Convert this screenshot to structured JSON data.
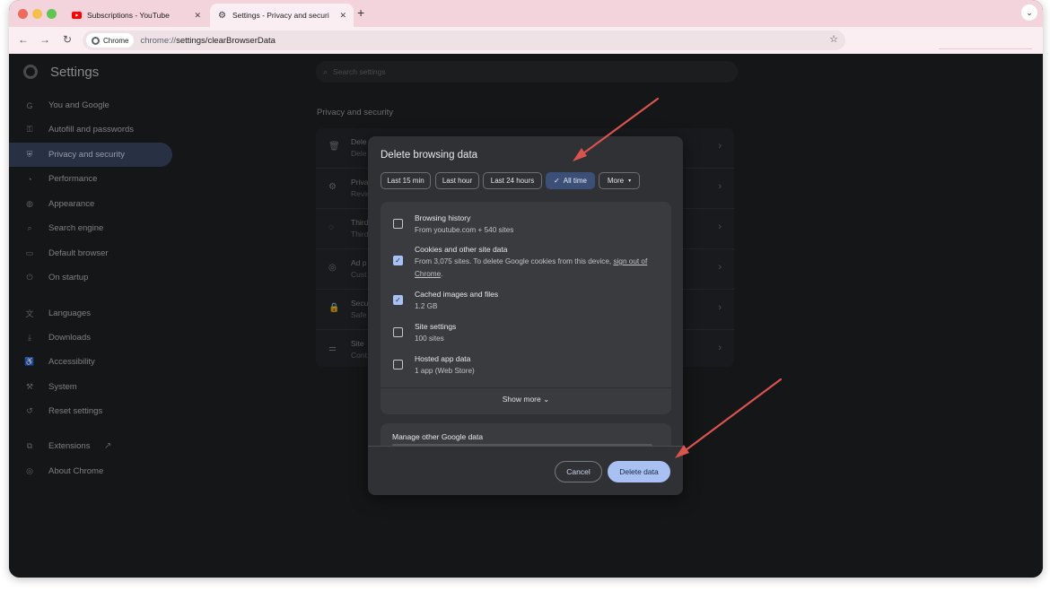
{
  "tabs": [
    {
      "title": "Subscriptions - YouTube",
      "icon": "youtube-icon",
      "close": "✕"
    },
    {
      "title": "Settings - Privacy and securi",
      "icon": "gear-icon",
      "close": "✕"
    }
  ],
  "new_tab": "+",
  "tab_menu": "⌄",
  "toolbar": {
    "back": "←",
    "forward": "→",
    "reload": "↻",
    "chip_label": "Chrome",
    "url_scheme": "chrome://",
    "url_rest": "settings/clearBrowserData",
    "star": "☆"
  },
  "settings": {
    "title": "Settings",
    "search_placeholder": "Search settings",
    "nav": [
      {
        "label": "You and Google",
        "icon": "google-icon",
        "glyph": "G"
      },
      {
        "label": "Autofill and passwords",
        "icon": "key-icon",
        "glyph": "⚿"
      },
      {
        "label": "Privacy and security",
        "icon": "shield-icon",
        "glyph": "⛨"
      },
      {
        "label": "Performance",
        "icon": "speedometer-icon",
        "glyph": "◔"
      },
      {
        "label": "Appearance",
        "icon": "palette-icon",
        "glyph": "◍"
      },
      {
        "label": "Search engine",
        "icon": "search-icon",
        "glyph": "⌕"
      },
      {
        "label": "Default browser",
        "icon": "browser-icon",
        "glyph": "▭"
      },
      {
        "label": "On startup",
        "icon": "power-icon",
        "glyph": "⏻"
      },
      {
        "label": "Languages",
        "icon": "translate-icon",
        "glyph": "文"
      },
      {
        "label": "Downloads",
        "icon": "download-icon",
        "glyph": "⤓"
      },
      {
        "label": "Accessibility",
        "icon": "accessibility-icon",
        "glyph": "♿"
      },
      {
        "label": "System",
        "icon": "wrench-icon",
        "glyph": "⚒"
      },
      {
        "label": "Reset settings",
        "icon": "reset-icon",
        "glyph": "↺"
      },
      {
        "label": "Extensions",
        "icon": "puzzle-icon",
        "glyph": "⧉"
      },
      {
        "label": "About Chrome",
        "icon": "chrome-icon",
        "glyph": "◎"
      }
    ],
    "extensions_external": "↗",
    "section_title": "Privacy and security",
    "rows": [
      {
        "title": "Dele",
        "sub": "Dele",
        "icon": "trash-icon",
        "glyph": "🗑"
      },
      {
        "title": "Priva",
        "sub": "Revie",
        "icon": "privacy-guide-icon",
        "glyph": "⚙"
      },
      {
        "title": "Third",
        "sub": "Third",
        "icon": "cookie-icon",
        "glyph": "◌"
      },
      {
        "title": "Ad p",
        "sub": "Cust",
        "icon": "ad-privacy-icon",
        "glyph": "◎"
      },
      {
        "title": "Secu",
        "sub": "Safe",
        "icon": "lock-icon",
        "glyph": "🔒"
      },
      {
        "title": "Site",
        "sub": "Cont",
        "icon": "sliders-icon",
        "glyph": "⚌"
      }
    ],
    "row_arrow": "›"
  },
  "dialog": {
    "title": "Delete browsing data",
    "ranges": [
      {
        "label": "Last 15 min",
        "selected": false
      },
      {
        "label": "Last hour",
        "selected": false
      },
      {
        "label": "Last 24 hours",
        "selected": false
      },
      {
        "label": "All time",
        "selected": true
      },
      {
        "label": "More",
        "selected": false
      }
    ],
    "check_glyph": "✓",
    "dropdown_glyph": "▾",
    "items": [
      {
        "title": "Browsing history",
        "sub": "From youtube.com + 540 sites",
        "checked": false
      },
      {
        "title": "Cookies and other site data",
        "sub": "From 3,075 sites. To delete Google cookies from this device, ",
        "link": "sign out of Chrome",
        "sub_end": ".",
        "checked": true
      },
      {
        "title": "Cached images and files",
        "sub": "1.2 GB",
        "checked": true
      },
      {
        "title": "Site settings",
        "sub": "100 sites",
        "checked": false
      },
      {
        "title": "Hosted app data",
        "sub": "1 app (Web Store)",
        "checked": false
      }
    ],
    "show_more": "Show more",
    "show_more_chevron": "⌄",
    "manage_title": "Manage other Google data",
    "cancel": "Cancel",
    "delete": "Delete data"
  },
  "colors": {
    "accent": "#a8c0f2",
    "selected_range": "#3b4f77",
    "annotation_arrow": "#d9534f",
    "tabstrip": "#f3d3dc"
  }
}
